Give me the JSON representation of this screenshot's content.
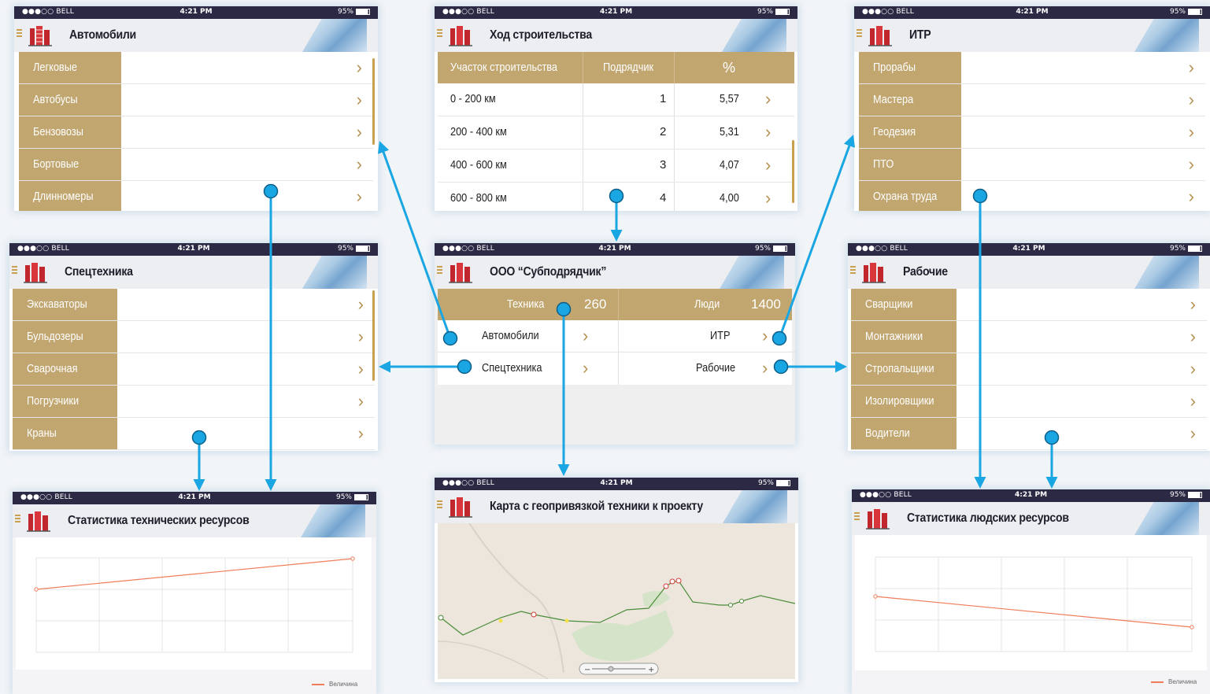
{
  "status": {
    "carrier": "●●●○○ BELL",
    "time": "4:21 PM",
    "battery": "95%"
  },
  "screens": {
    "cars": {
      "title": "Автомобили",
      "items": [
        "Легковые",
        "Автобусы",
        "Бензовозы",
        "Бортовые",
        "Длинномеры"
      ]
    },
    "progress": {
      "title": "Ход строительства",
      "headers": [
        "Участок строительства",
        "Подрядчик",
        "%"
      ],
      "rows": [
        [
          "0 - 200 км",
          "1",
          "5,57"
        ],
        [
          "200 - 400 км",
          "2",
          "5,31"
        ],
        [
          "400 - 600 км",
          "3",
          "4,07"
        ],
        [
          "600 - 800 км",
          "4",
          "4,00"
        ]
      ]
    },
    "itr": {
      "title": "ИТР",
      "items": [
        "Прорабы",
        "Мастера",
        "Геодезия",
        "ПТО",
        "Охрана труда"
      ]
    },
    "special": {
      "title": "Спецтехника",
      "items": [
        "Экскаваторы",
        "Бульдозеры",
        "Сварочная",
        "Погрузчики",
        "Краны"
      ]
    },
    "company": {
      "title": "ООО “Субподрядчик”",
      "tech_label": "Техника",
      "tech_value": "260",
      "people_label": "Люди",
      "people_value": "1400",
      "left_items": [
        "Автомобили",
        "Спецтехника"
      ],
      "right_items": [
        "ИТР",
        "Рабочие"
      ]
    },
    "workers": {
      "title": "Рабочие",
      "items": [
        "Сварщики",
        "Монтажники",
        "Стропальщики",
        "Изолировщики",
        "Водители"
      ]
    },
    "tech_stats": {
      "title": "Статистика технических ресурсов",
      "legend": "Величина"
    },
    "map": {
      "title": "Карта с геопривязкой техники к проекту",
      "zoom_minus": "−",
      "zoom_plus": "+"
    },
    "people_stats": {
      "title": "Статистика людских ресурсов",
      "legend": "Величина"
    }
  },
  "colors": {
    "accent": "#c1a670",
    "statusbar": "#2c2945",
    "arrow": "#1aa6e2",
    "line": "#f07d5a"
  }
}
